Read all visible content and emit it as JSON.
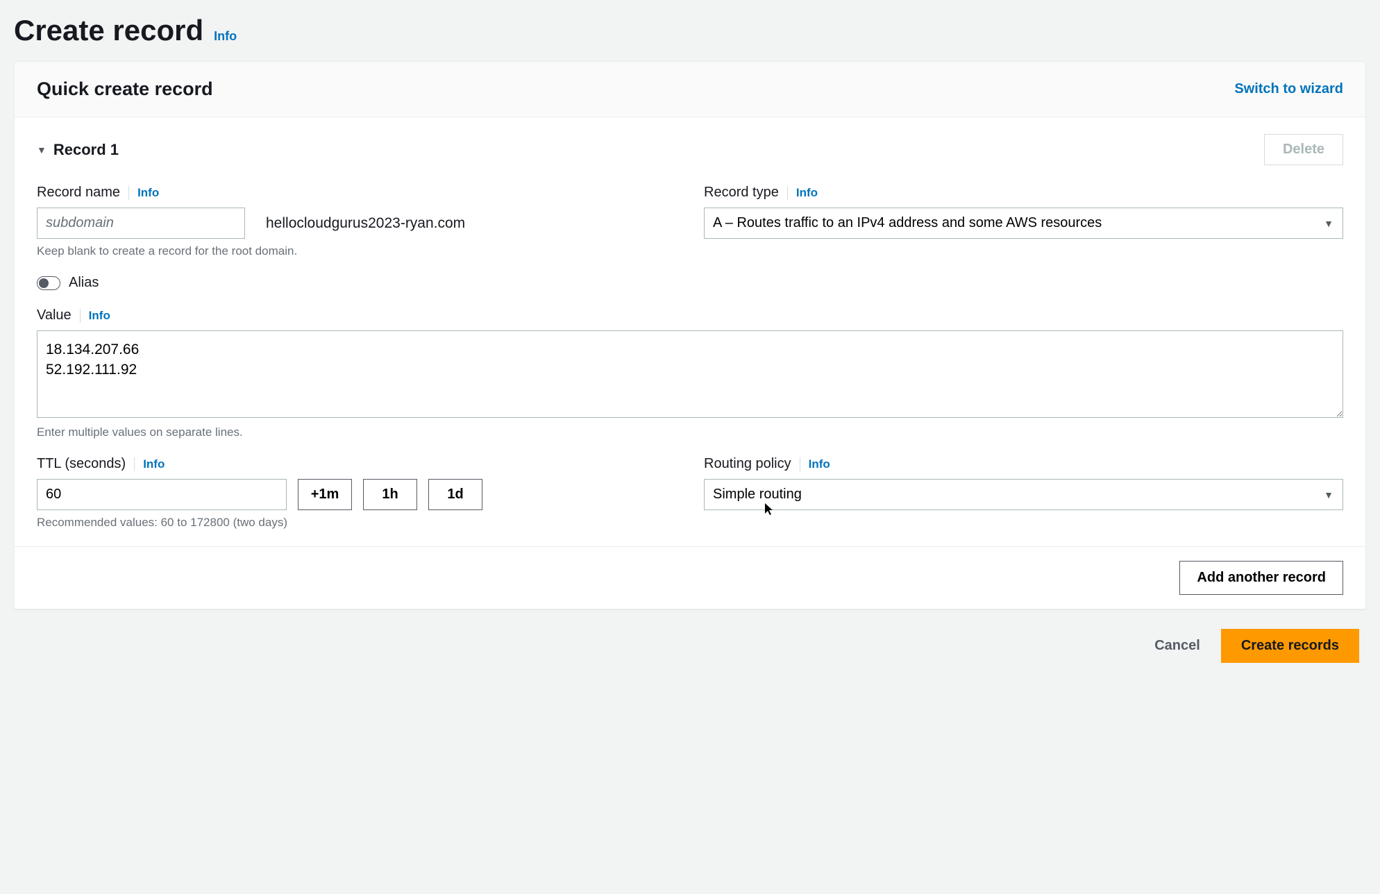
{
  "page": {
    "title": "Create record",
    "info": "Info"
  },
  "panel": {
    "title": "Quick create record",
    "switch_link": "Switch to wizard"
  },
  "record": {
    "title": "Record 1",
    "delete_label": "Delete",
    "name": {
      "label": "Record name",
      "info": "Info",
      "placeholder": "subdomain",
      "value": "",
      "suffix": "hellocloudgurus2023-ryan.com",
      "help": "Keep blank to create a record for the root domain."
    },
    "type": {
      "label": "Record type",
      "info": "Info",
      "selected": "A – Routes traffic to an IPv4 address and some AWS resources"
    },
    "alias": {
      "label": "Alias",
      "enabled": false
    },
    "value": {
      "label": "Value",
      "info": "Info",
      "content": "18.134.207.66\n52.192.111.92",
      "help": "Enter multiple values on separate lines."
    },
    "ttl": {
      "label": "TTL (seconds)",
      "info": "Info",
      "value": "60",
      "presets": {
        "p1": "+1m",
        "p2": "1h",
        "p3": "1d"
      },
      "help": "Recommended values: 60 to 172800 (two days)"
    },
    "routing": {
      "label": "Routing policy",
      "info": "Info",
      "selected": "Simple routing"
    }
  },
  "footer": {
    "add_another": "Add another record",
    "cancel": "Cancel",
    "create": "Create records"
  }
}
